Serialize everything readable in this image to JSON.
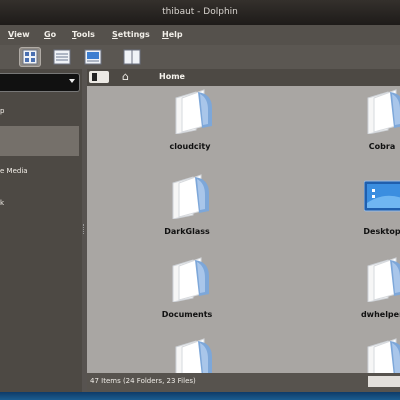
{
  "window": {
    "title": "thibaut - Dolphin"
  },
  "menubar": {
    "items": [
      {
        "label": "View",
        "underline": "V",
        "rest": "iew"
      },
      {
        "label": "Go",
        "underline": "G",
        "rest": "o"
      },
      {
        "label": "Tools",
        "underline": "T",
        "rest": "ools"
      },
      {
        "label": "Settings",
        "underline": "S",
        "rest": "ettings"
      },
      {
        "label": "Help",
        "underline": "H",
        "rest": "elp"
      }
    ]
  },
  "toolbar": {
    "buttons": [
      {
        "name": "icons-view",
        "active": true
      },
      {
        "name": "details-view",
        "active": false
      },
      {
        "name": "preview-view",
        "active": false
      },
      {
        "name": "split-view",
        "active": false
      }
    ]
  },
  "sidebar": {
    "items": [
      {
        "label": "p"
      },
      {
        "label": "e Media"
      },
      {
        "label": "k"
      }
    ]
  },
  "location": {
    "label": "Home",
    "icon": "home-icon"
  },
  "folders": [
    {
      "name": "cloudcity",
      "icon": "folder-icon"
    },
    {
      "name": "Cobra",
      "icon": "folder-icon"
    },
    {
      "name": "DarkGlass",
      "icon": "folder-icon"
    },
    {
      "name": "Desktop",
      "icon": "desktop-folder-icon"
    },
    {
      "name": "Documents",
      "icon": "folder-icon"
    },
    {
      "name": "dwhelper",
      "icon": "folder-icon"
    },
    {
      "name": "",
      "icon": "folder-icon"
    },
    {
      "name": "",
      "icon": "folder-icon"
    }
  ],
  "statusbar": {
    "text": "47 Items (24 Folders, 23 Files)"
  },
  "colors": {
    "accent": "#3d7ed0",
    "view_bg": "#a9a6a3",
    "chrome": "#4d4944"
  }
}
